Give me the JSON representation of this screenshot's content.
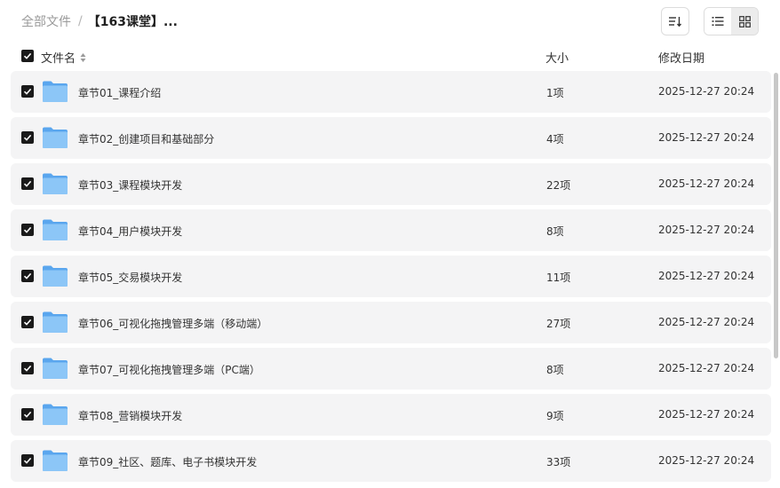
{
  "breadcrumb": {
    "root": "全部文件",
    "separator": "/",
    "current": "【163课堂】..."
  },
  "header": {
    "name": "文件名",
    "size": "大小",
    "date": "修改日期"
  },
  "rows": [
    {
      "name": "章节01_课程介绍",
      "size": "1项",
      "date": "2025-12-27 20:24"
    },
    {
      "name": "章节02_创建项目和基础部分",
      "size": "4项",
      "date": "2025-12-27 20:24"
    },
    {
      "name": "章节03_课程模块开发",
      "size": "22项",
      "date": "2025-12-27 20:24"
    },
    {
      "name": "章节04_用户模块开发",
      "size": "8项",
      "date": "2025-12-27 20:24"
    },
    {
      "name": "章节05_交易模块开发",
      "size": "11项",
      "date": "2025-12-27 20:24"
    },
    {
      "name": "章节06_可视化拖拽管理多端（移动端）",
      "size": "27项",
      "date": "2025-12-27 20:24"
    },
    {
      "name": "章节07_可视化拖拽管理多端（PC端）",
      "size": "8项",
      "date": "2025-12-27 20:24"
    },
    {
      "name": "章节08_营销模块开发",
      "size": "9项",
      "date": "2025-12-27 20:24"
    },
    {
      "name": "章节09_社区、题库、电子书模块开发",
      "size": "33项",
      "date": "2025-12-27 20:24"
    }
  ],
  "icons": {
    "sort": "sort-lines-icon",
    "list_view": "list-view-icon",
    "grid_view": "grid-view-icon",
    "folder": "folder-icon",
    "checkbox": "checkmark-icon"
  },
  "colors": {
    "folder": "#6fb3f2",
    "row_bg": "#f4f4f5",
    "checkbox": "#1a1a1a"
  }
}
